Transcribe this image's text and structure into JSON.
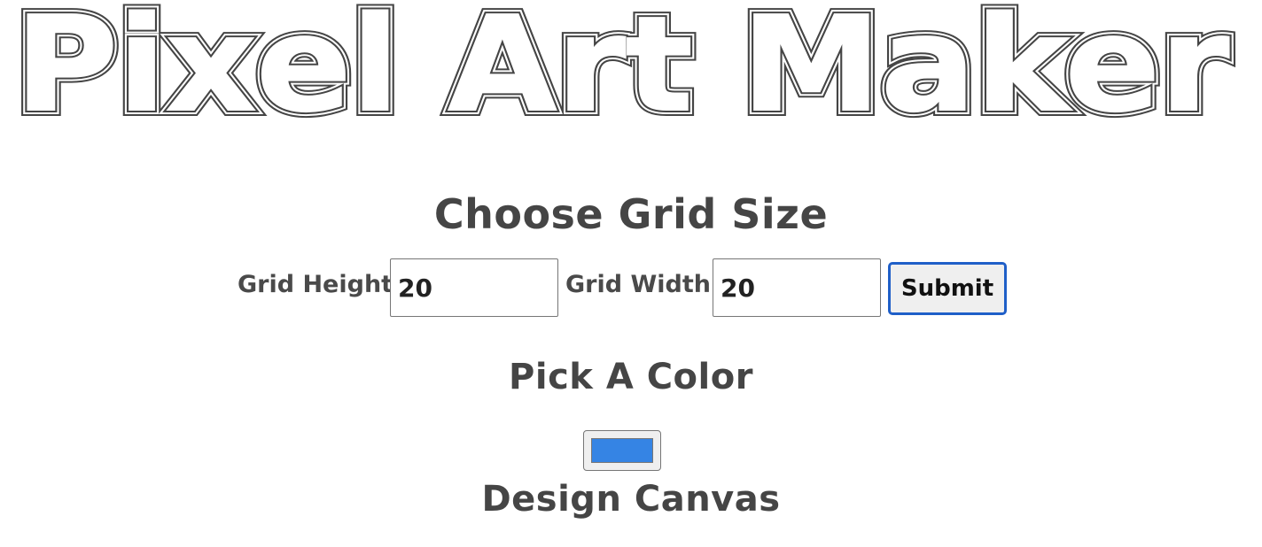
{
  "app": {
    "title": "Pixel Art Maker"
  },
  "grid_section": {
    "heading": "Choose Grid Size",
    "height_label": "Grid Height:",
    "height_value": "20",
    "width_label": "Grid Width:",
    "width_value": "20",
    "submit_label": "Submit"
  },
  "color_section": {
    "heading": "Pick A Color",
    "selected_color": "#3584e4"
  },
  "canvas_section": {
    "heading": "Design Canvas"
  },
  "colors": {
    "title_stroke": "#454545",
    "heading_text": "#454545",
    "submit_border": "#1f5fc8"
  }
}
